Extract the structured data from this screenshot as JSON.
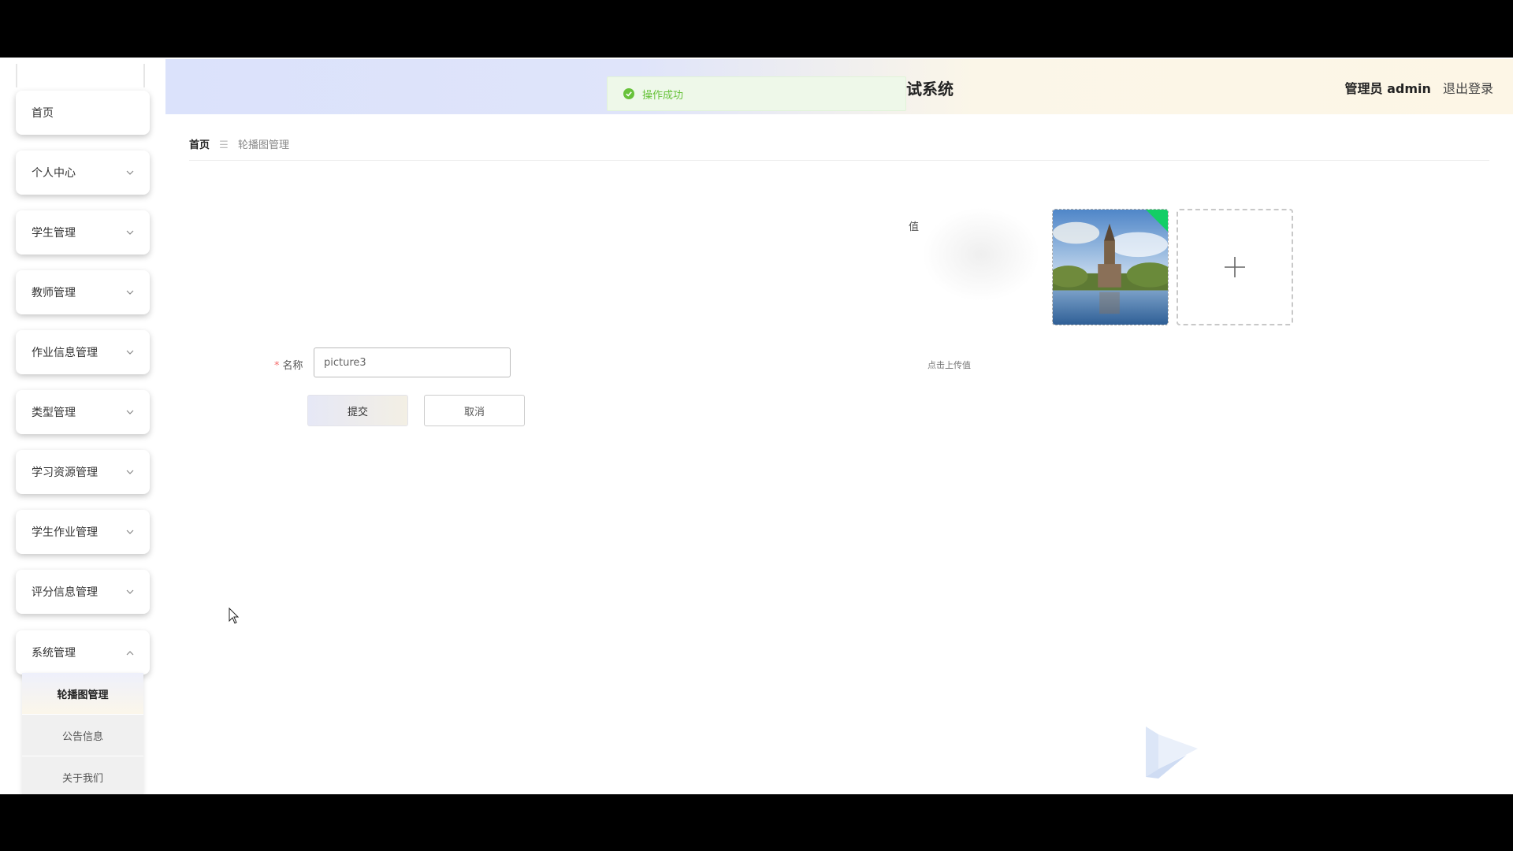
{
  "header": {
    "system_title": "试系统",
    "user_name": "管理员 admin",
    "logout": "退出登录"
  },
  "toast": {
    "message": "操作成功",
    "color": "#67c23a"
  },
  "sidebar": {
    "items": [
      {
        "label": "首页",
        "has_chevron": false
      },
      {
        "label": "个人中心",
        "has_chevron": true
      },
      {
        "label": "学生管理",
        "has_chevron": true
      },
      {
        "label": "教师管理",
        "has_chevron": true
      },
      {
        "label": "作业信息管理",
        "has_chevron": true
      },
      {
        "label": "类型管理",
        "has_chevron": true
      },
      {
        "label": "学习资源管理",
        "has_chevron": true
      },
      {
        "label": "学生作业管理",
        "has_chevron": true
      },
      {
        "label": "评分信息管理",
        "has_chevron": true
      },
      {
        "label": "系统管理",
        "has_chevron": true,
        "expanded": true
      }
    ],
    "submenu": [
      {
        "label": "轮播图管理",
        "active": true
      },
      {
        "label": "公告信息",
        "active": false
      },
      {
        "label": "关于我们",
        "active": false
      }
    ]
  },
  "breadcrumb": {
    "home": "首页",
    "separator_icon": "menu-separator-icon",
    "current": "轮播图管理"
  },
  "form": {
    "name_label": "名称",
    "name_required_mark": "*",
    "name_value": "picture3",
    "value_label": "值",
    "upload_hint": "点击上传值",
    "submit_label": "提交",
    "cancel_label": "取消"
  },
  "colors": {
    "required": "#f56c6c",
    "upload_success": "#13ce66"
  }
}
